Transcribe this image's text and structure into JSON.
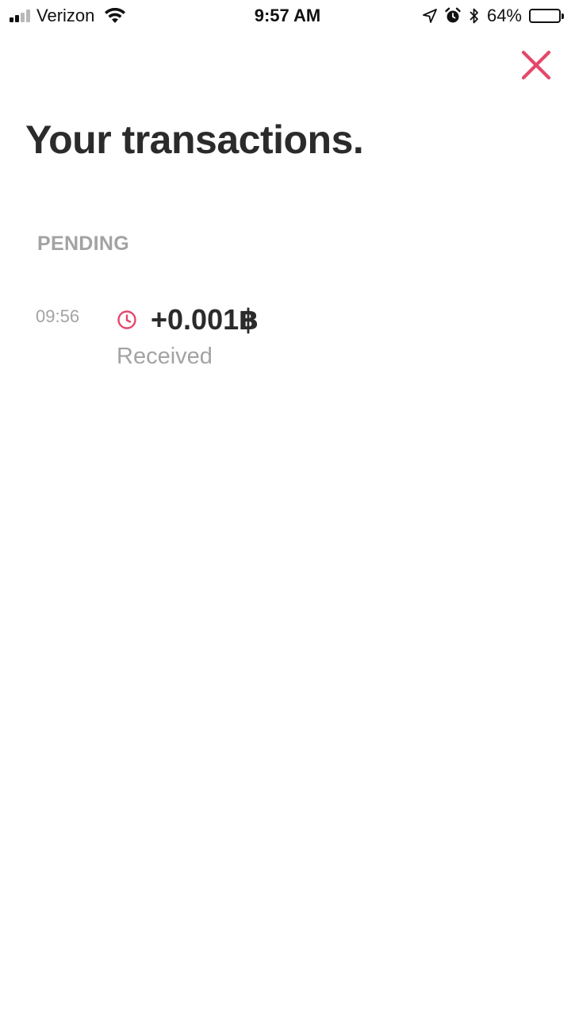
{
  "status_bar": {
    "carrier": "Verizon",
    "time": "9:57 AM",
    "battery_percent": "64%",
    "battery_level": 0.64,
    "signal_bars_filled": 2,
    "signal_bars_total": 4,
    "icons": [
      "wifi-icon",
      "location-arrow-icon",
      "alarm-icon",
      "bluetooth-icon",
      "battery-icon"
    ]
  },
  "header": {
    "title": "Your transactions.",
    "close_icon": "close-icon",
    "accent_color": "#e5476b"
  },
  "sections": [
    {
      "label": "PENDING",
      "transactions": [
        {
          "time": "09:56",
          "status_icon": "clock-icon",
          "amount": "+0.001฿",
          "type": "Received"
        }
      ]
    }
  ],
  "colors": {
    "text_primary": "#2b2b2b",
    "text_secondary": "#a3a3a3",
    "accent": "#e5476b",
    "background": "#ffffff"
  }
}
